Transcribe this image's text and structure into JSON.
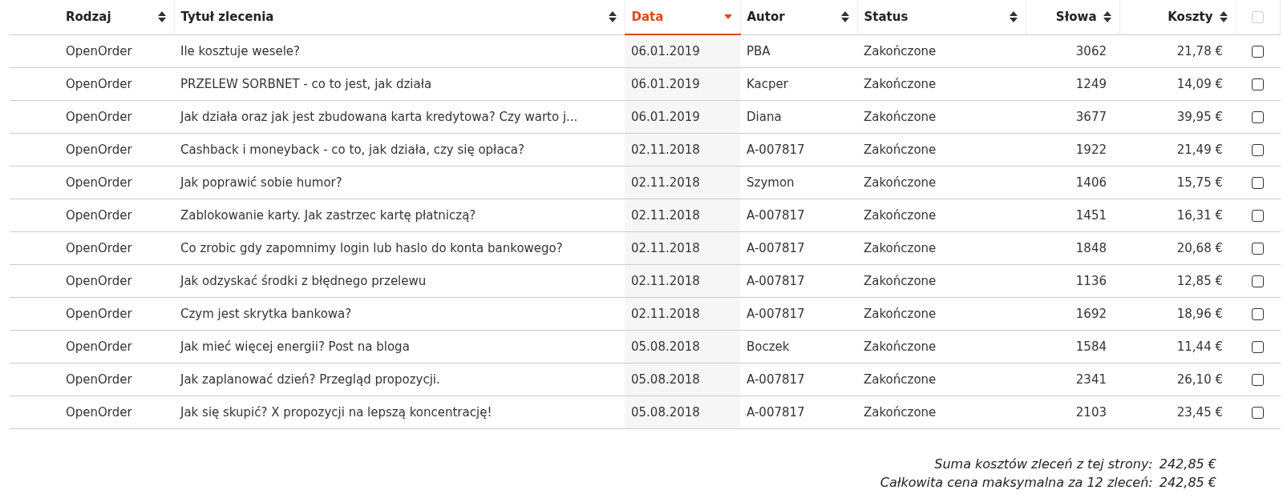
{
  "table": {
    "columns": [
      {
        "label": "Rodzaj",
        "kind": "text",
        "selected": false
      },
      {
        "label": "Tytuł zlecenia",
        "kind": "text",
        "selected": false
      },
      {
        "label": "Data",
        "kind": "text",
        "selected": true
      },
      {
        "label": "Autor",
        "kind": "text",
        "selected": false
      },
      {
        "label": "Status",
        "kind": "text",
        "selected": false
      },
      {
        "label": "Słowa",
        "kind": "number",
        "selected": false
      },
      {
        "label": "Koszty",
        "kind": "number",
        "selected": false
      }
    ],
    "select_all": {
      "checked": false
    },
    "rows": [
      {
        "cells": [
          "OpenOrder",
          "Ile kosztuje wesele?",
          "06.01.2019",
          "PBA",
          "Zakończone",
          "3062",
          "21,78 €"
        ],
        "checked": false
      },
      {
        "cells": [
          "OpenOrder",
          "PRZELEW SORBNET - co to jest, jak działa",
          "06.01.2019",
          "Kacper",
          "Zakończone",
          "1249",
          "14,09 €"
        ],
        "checked": false
      },
      {
        "cells": [
          "OpenOrder",
          "Jak działa oraz jak jest zbudowana karta kredytowa? Czy warto j...",
          "06.01.2019",
          "Diana",
          "Zakończone",
          "3677",
          "39,95 €"
        ],
        "checked": false
      },
      {
        "cells": [
          "OpenOrder",
          "Cashback i moneyback - co to, jak działa, czy się opłaca?",
          "02.11.2018",
          "A-007817",
          "Zakończone",
          "1922",
          "21,49 €"
        ],
        "checked": false
      },
      {
        "cells": [
          "OpenOrder",
          "Jak poprawić sobie humor?",
          "02.11.2018",
          "Szymon",
          "Zakończone",
          "1406",
          "15,75 €"
        ],
        "checked": false
      },
      {
        "cells": [
          "OpenOrder",
          "Zablokowanie karty. Jak zastrzec kartę płatniczą?",
          "02.11.2018",
          "A-007817",
          "Zakończone",
          "1451",
          "16,31 €"
        ],
        "checked": false
      },
      {
        "cells": [
          "OpenOrder",
          "Co zrobic gdy zapomnimy login lub haslo do konta bankowego?",
          "02.11.2018",
          "A-007817",
          "Zakończone",
          "1848",
          "20,68 €"
        ],
        "checked": false
      },
      {
        "cells": [
          "OpenOrder",
          "Jak odzyskać środki z błędnego przelewu",
          "02.11.2018",
          "A-007817",
          "Zakończone",
          "1136",
          "12,85 €"
        ],
        "checked": false
      },
      {
        "cells": [
          "OpenOrder",
          "Czym jest skrytka bankowa?",
          "02.11.2018",
          "A-007817",
          "Zakończone",
          "1692",
          "18,96 €"
        ],
        "checked": false
      },
      {
        "cells": [
          "OpenOrder",
          "Jak mieć więcej energii? Post na bloga",
          "05.08.2018",
          "Boczek",
          "Zakończone",
          "1584",
          "11,44 €"
        ],
        "checked": false
      },
      {
        "cells": [
          "OpenOrder",
          "Jak zaplanować dzień? Przegląd propozycji.",
          "05.08.2018",
          "A-007817",
          "Zakończone",
          "2341",
          "26,10 €"
        ],
        "checked": false
      },
      {
        "cells": [
          "OpenOrder",
          "Jak się skupić? X propozycji na lepszą koncentrację!",
          "05.08.2018",
          "A-007817",
          "Zakończone",
          "2103",
          "23,45 €"
        ],
        "checked": false
      }
    ]
  },
  "summary": [
    {
      "label": "Suma kosztów zleceń z tej strony:",
      "value": "242,85 €"
    },
    {
      "label": "Całkowita cena maksymalna za 12 zleceń:",
      "value": "242,85 €"
    }
  ]
}
